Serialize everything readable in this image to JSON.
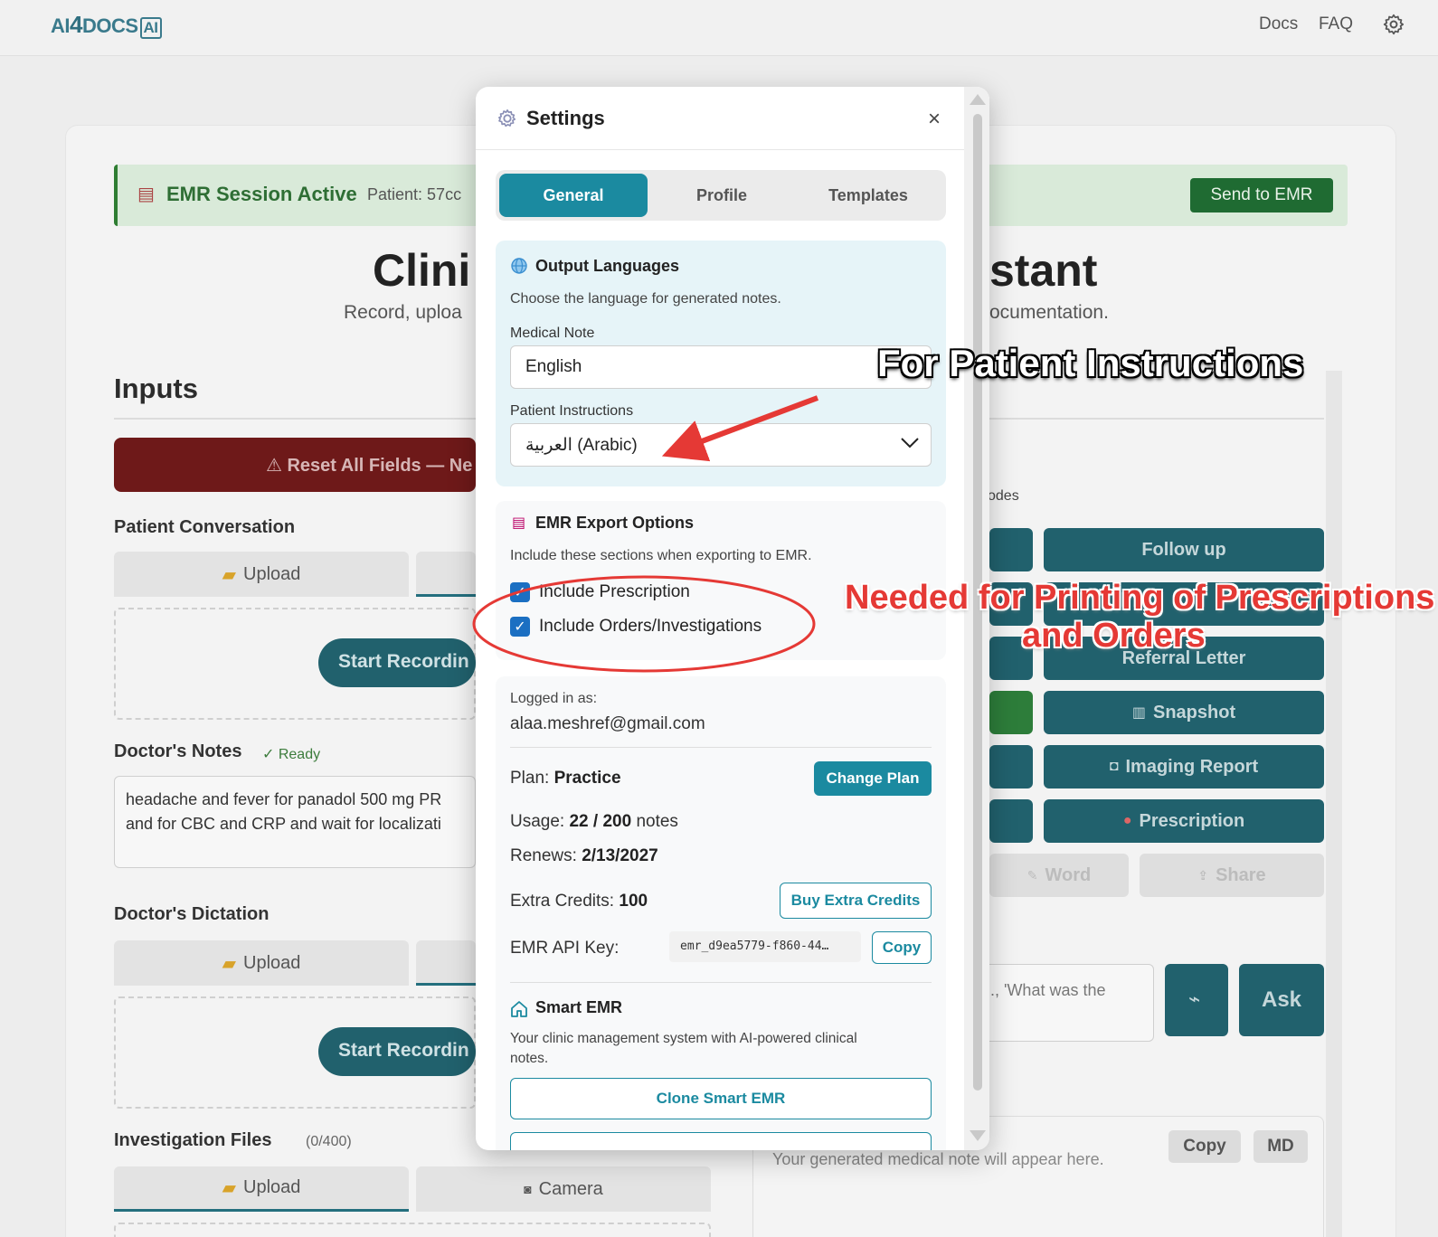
{
  "topbar": {
    "logo": {
      "part1": "AI",
      "part2": "4",
      "part3": "DOCS",
      "part4": "AI"
    },
    "nav_docs": "Docs",
    "nav_faq": "FAQ",
    "settings_icon": "gear-icon"
  },
  "background": {
    "emr_banner_title": "EMR Session Active",
    "emr_banner_patient": "Patient: 57cc",
    "send_emr": "Send to EMR",
    "title_left": "Clini",
    "title_right": "stant",
    "subtitle_left": "Record, uploa",
    "subtitle_right": "ocumentation.",
    "inputs_heading": "Inputs",
    "reset_button": "⚠ Reset All Fields — Ne",
    "patient_conversation": "Patient Conversation",
    "upload_label": "Upload",
    "start_recording": "Start Recordin",
    "doctors_notes": "Doctor's Notes",
    "ready_status": "✓ Ready",
    "notes_text_line1": "headache and fever for panadol 500 mg PR",
    "notes_text_line2": "and for CBC and CRP and wait for localizati",
    "doctors_dictation": "Doctor's Dictation",
    "investigation_files": "Investigation Files",
    "investigation_count": "(0/400)",
    "camera_label": "Camera",
    "codes_fragment": "odes",
    "buttons": {
      "follow_up": "Follow up",
      "referral_letter": "Referral Letter",
      "snapshot": "Snapshot",
      "imaging_report": "Imaging Report",
      "prescription": "Prescription",
      "word": "Word",
      "share": "Share"
    },
    "ask_placeholder": "., 'What was the",
    "ask_button": "Ask",
    "output_placeholder": "Your generated medical note will appear here.",
    "copy_button": "Copy",
    "md_button": "MD"
  },
  "modal": {
    "title": "Settings",
    "close": "×",
    "tabs": [
      "General",
      "Profile",
      "Templates"
    ],
    "active_tab": "General",
    "output_languages": {
      "heading": "Output Languages",
      "description": "Choose the language for generated notes.",
      "medical_note_label": "Medical Note",
      "medical_note_value": "English",
      "patient_instructions_label": "Patient Instructions",
      "patient_instructions_value": "العربية (Arabic)"
    },
    "emr_export": {
      "heading": "EMR Export Options",
      "description": "Include these sections when exporting to EMR.",
      "include_prescription": "Include Prescription",
      "include_prescription_checked": true,
      "include_orders": "Include Orders/Investigations",
      "include_orders_checked": true
    },
    "account": {
      "logged_in_label": "Logged in as:",
      "email": "alaa.meshref@gmail.com",
      "plan_label": "Plan:",
      "plan_value": "Practice",
      "change_plan": "Change Plan",
      "usage_label": "Usage:",
      "usage_value": "22 / 200",
      "usage_unit": "notes",
      "renews_label": "Renews:",
      "renews_value": "2/13/2027",
      "extra_credits_label": "Extra Credits:",
      "extra_credits_value": "100",
      "buy_extra_credits": "Buy Extra Credits",
      "api_key_label": "EMR API Key:",
      "api_key_value": "emr_d9ea5779-f860-44…",
      "copy": "Copy"
    },
    "smart_emr": {
      "heading": "Smart EMR",
      "description_line1": "Your clinic management system with AI-powered clinical",
      "description_line2": "notes.",
      "clone_button": "Clone Smart EMR"
    }
  },
  "annotations": {
    "patient_instructions_note": "For Patient Instructions",
    "printing_note_line1": "Needed for Printing of Prescriptions",
    "printing_note_line2": "and Orders"
  },
  "colors": {
    "accent": "#1b8aa0",
    "checkbox": "#1b6fc2",
    "annotation_red": "#e53935",
    "emr_green": "#2e7d32"
  }
}
